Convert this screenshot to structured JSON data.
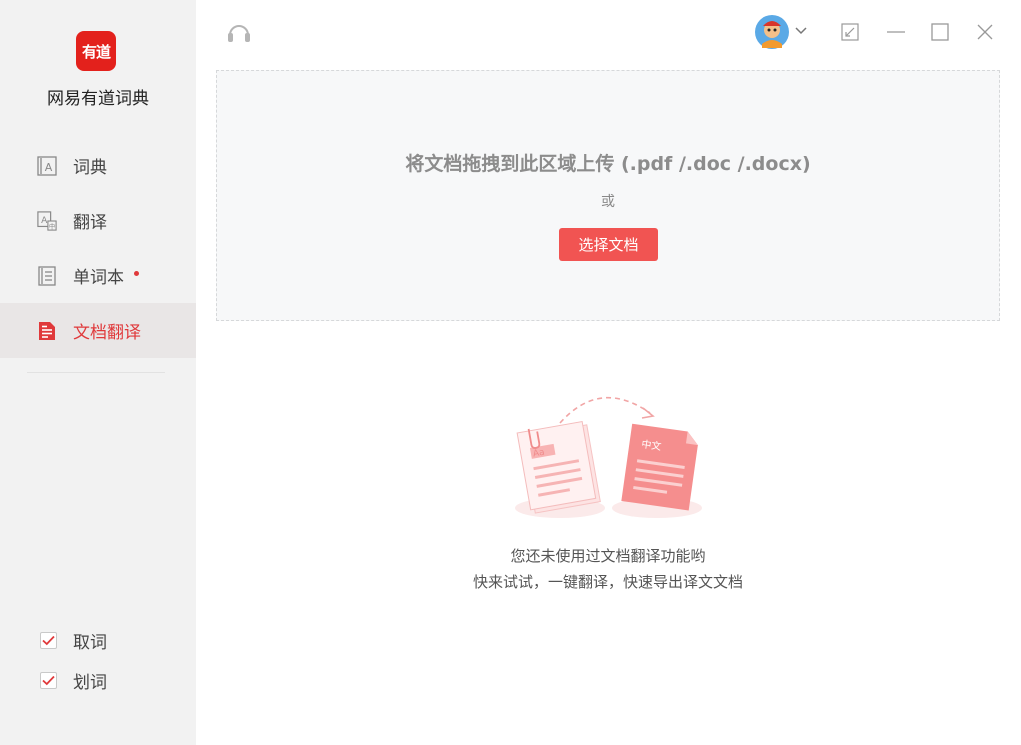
{
  "app": {
    "logo_text": "有道",
    "name": "网易有道词典"
  },
  "sidebar": {
    "items": [
      {
        "label": "词典",
        "icon": "dictionary-icon"
      },
      {
        "label": "翻译",
        "icon": "translate-icon"
      },
      {
        "label": "单词本",
        "icon": "wordbook-icon",
        "badge": "red-dot"
      },
      {
        "label": "文档翻译",
        "icon": "document-icon",
        "active": true
      }
    ],
    "checkboxes": [
      {
        "label": "取词",
        "checked": true
      },
      {
        "label": "划词",
        "checked": true
      }
    ]
  },
  "topbar": {
    "support_icon": "headset-icon",
    "avatar_icon": "avatar",
    "window_controls": [
      "shrink-icon",
      "minimize-icon",
      "maximize-icon",
      "close-icon"
    ]
  },
  "upload": {
    "title": "将文档拖拽到此区域上传 (.pdf /.doc /.docx)",
    "or_text": "或",
    "button_label": "选择文档"
  },
  "illustration": {
    "source_tag": "Aa",
    "target_tag": "中文"
  },
  "empty_state": {
    "line1": "您还未使用过文档翻译功能哟",
    "line2": "快来试试，一键翻译，快速导出译文文档"
  },
  "colors": {
    "accent": "#f15452",
    "active_text": "#e0393b",
    "sidebar_bg": "#f2f2f2",
    "logo_bg": "#e3211c"
  }
}
